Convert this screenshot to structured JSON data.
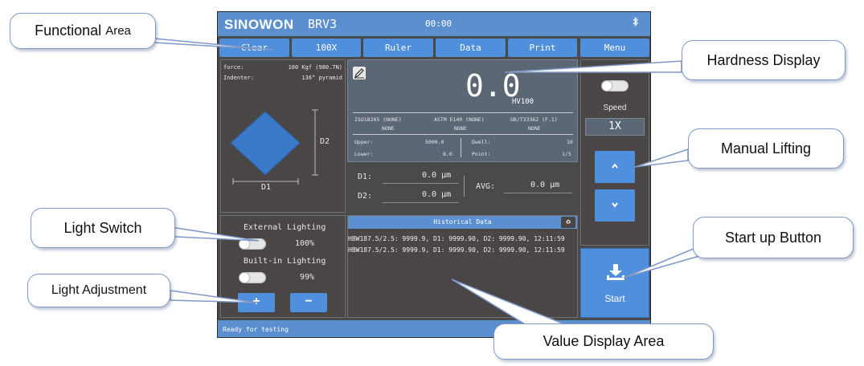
{
  "device": {
    "brand": "SINOWON",
    "model": "BRV3",
    "clock": "00:00",
    "bluetooth_icon": "bluetooth-icon"
  },
  "menu": {
    "items": [
      "Clear",
      "100X",
      "Ruler",
      "Data",
      "Print",
      "Menu"
    ]
  },
  "indenter": {
    "force_label": "force:",
    "force_value": "100 Kgf (980.7N)",
    "indenter_label": "Indenter:",
    "indenter_value": "136° pyramid",
    "d1_label": "D1",
    "d2_label": "D2",
    "shape_color": "#3a78c8"
  },
  "lighting": {
    "external_label": "External Lighting",
    "external_value": "100%",
    "builtin_label": "Built-in Lighting",
    "builtin_value": "99%",
    "plus": "+",
    "minus": "−"
  },
  "hardness": {
    "value": "0.0",
    "unit": "HV100",
    "standards": [
      {
        "name": "ISO18265 (NONE)",
        "value": "NONE"
      },
      {
        "name": "ASTM E140 (NONE)",
        "value": "NONE"
      },
      {
        "name": "GB/T33362 (F.1)",
        "value": "NONE"
      }
    ],
    "upper_label": "Upper:",
    "upper_value": "5000.0",
    "lower_label": "Lower:",
    "lower_value": "8.0",
    "dwell_label": "Dwell:",
    "dwell_value": "10",
    "point_label": "Point:",
    "point_value": "1/5"
  },
  "measure": {
    "d1_label": "D1:",
    "d1_value": "0.0 μm",
    "d2_label": "D2:",
    "d2_value": "0.0 μm",
    "avg_label": "AVG:",
    "avg_value": "0.0 μm"
  },
  "history": {
    "title": "Historical Data",
    "rows": [
      "HBW187.5/2.5: 9999.9, D1: 9999.90, D2: 9999.90, 12:11:59",
      "HBW187.5/2.5: 9999.9, D1: 9999.90, D2: 9999.90, 12:11:59"
    ]
  },
  "lift": {
    "speed_label": "Speed",
    "speed_value": "1X"
  },
  "start": {
    "label": "Start"
  },
  "status": {
    "text": "Ready for testing"
  },
  "callouts": {
    "functional_a": "Functional",
    "functional_b": "Area",
    "hardness_display": "Hardness Display",
    "manual_lifting": "Manual Lifting",
    "light_switch": "Light Switch",
    "light_adjustment": "Light Adjustment",
    "start_up_button": "Start up Button",
    "value_display_area": "Value Display Area"
  },
  "colors": {
    "accent": "#4f8fdb",
    "titlebar": "#5b8fd0",
    "panel_bg": "#4a4646",
    "hardness_bg": "#5b6775",
    "callout_border": "#7f98c8"
  }
}
